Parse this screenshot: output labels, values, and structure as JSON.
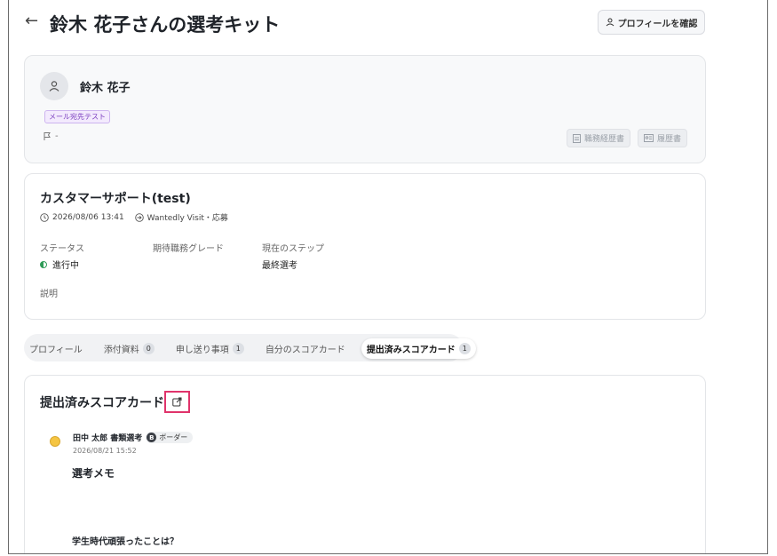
{
  "header": {
    "title": "鈴木 花子さんの選考キット",
    "profile_button": "プロフィールを確認"
  },
  "candidate": {
    "name": "鈴木 花子",
    "tag": "メール宛先テスト",
    "flag_text": "-",
    "doc_buttons": [
      "職務経歴書",
      "履歴書"
    ]
  },
  "job": {
    "title": "カスタマーサポート(test)",
    "datetime": "2026/08/06 13:41",
    "source": "Wantedly Visit・応募",
    "status_label": "ステータス",
    "status_value": "進行中",
    "grade_label": "期待職務グレード",
    "grade_value": "",
    "step_label": "現在のステップ",
    "step_value": "最終選考",
    "desc_label": "説明"
  },
  "tabs": [
    {
      "label": "プロフィール",
      "count": ""
    },
    {
      "label": "添付資料",
      "count": "0"
    },
    {
      "label": "申し送り事項",
      "count": "1"
    },
    {
      "label": "自分のスコアカード",
      "count": ""
    },
    {
      "label": "提出済みスコアカード",
      "count": "1"
    }
  ],
  "scorecard": {
    "title": "提出済みスコアカード",
    "evaluator": "田中 太郎 書類選考",
    "rating_badge": "B",
    "rating_label": "ボーダー",
    "date": "2026/08/21 15:52",
    "memo_heading": "選考メモ",
    "question": "学生時代頑張ったことは？"
  },
  "colors": {
    "accent_highlight": "#e0336b",
    "status_green": "#2e9b56",
    "tag_purple": "#7b3fbf"
  }
}
